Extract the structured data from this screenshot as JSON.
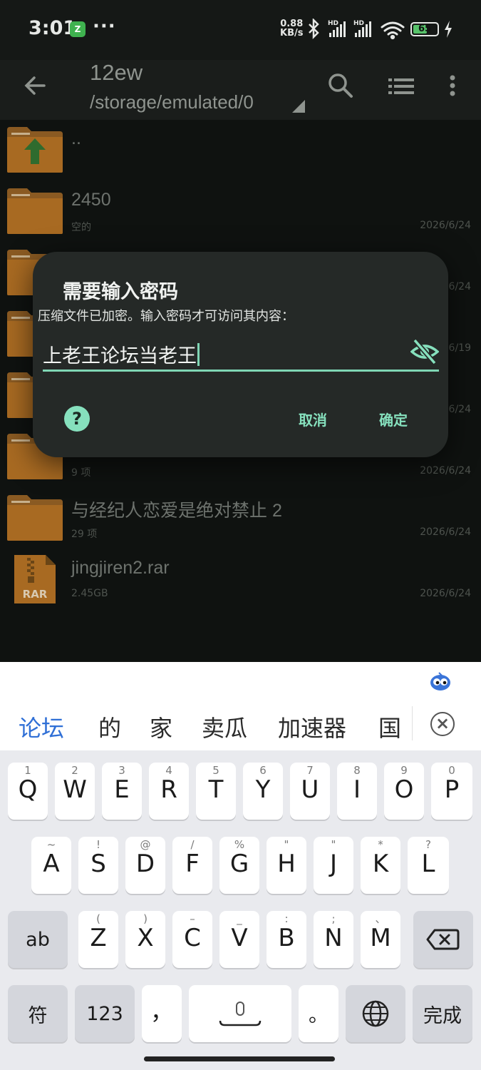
{
  "status_bar": {
    "time": "3:01",
    "app_badge": "Ⅸ",
    "dots": "···",
    "speed_value": "0.88",
    "speed_unit": "KB/s",
    "battery_level": "65",
    "icons": [
      "bluetooth-icon",
      "hd-signal-icon",
      "hd-signal-icon",
      "wifi-icon",
      "battery-icon",
      "charging-icon"
    ]
  },
  "app_bar": {
    "title": "12ew",
    "path": "/storage/emulated/0"
  },
  "files": [
    {
      "name": "..",
      "sub": "",
      "date": "",
      "type": "parent-folder"
    },
    {
      "name": "2450",
      "sub": "空的",
      "date": "2026/6/24",
      "type": "folder"
    },
    {
      "name": "",
      "sub": "",
      "date": "6/24",
      "type": "folder"
    },
    {
      "name": "",
      "sub": "",
      "date": "6/19",
      "type": "folder"
    },
    {
      "name": "",
      "sub": "",
      "date": "6/24",
      "type": "folder"
    },
    {
      "name": "",
      "sub": "9 项",
      "date": "2026/6/24",
      "type": "folder"
    },
    {
      "name": "与经纪人恋爱是绝对禁止 2",
      "sub": "29 项",
      "date": "2026/6/24",
      "type": "folder"
    },
    {
      "name": "jingjiren2.rar",
      "sub": "2.45GB",
      "date": "2026/6/24",
      "type": "rar"
    }
  ],
  "dialog": {
    "title": "需要输入密码",
    "message": "压缩文件已加密。输入密码才可访问其内容：",
    "password_value": "上老王论坛当老王",
    "help_label": "?",
    "cancel_label": "取消",
    "ok_label": "确定"
  },
  "keyboard": {
    "candidates": [
      "论坛",
      "的",
      "家",
      "卖瓜",
      "加速器",
      "国"
    ],
    "row1": [
      {
        "main": "Q",
        "sub": "1"
      },
      {
        "main": "W",
        "sub": "2"
      },
      {
        "main": "E",
        "sub": "3"
      },
      {
        "main": "R",
        "sub": "4"
      },
      {
        "main": "T",
        "sub": "5"
      },
      {
        "main": "Y",
        "sub": "6"
      },
      {
        "main": "U",
        "sub": "7"
      },
      {
        "main": "I",
        "sub": "8"
      },
      {
        "main": "O",
        "sub": "9"
      },
      {
        "main": "P",
        "sub": "0"
      }
    ],
    "row2": [
      {
        "main": "A",
        "sub": "~"
      },
      {
        "main": "S",
        "sub": "!"
      },
      {
        "main": "D",
        "sub": "@"
      },
      {
        "main": "F",
        "sub": "/"
      },
      {
        "main": "G",
        "sub": "%"
      },
      {
        "main": "H",
        "sub": "\""
      },
      {
        "main": "J",
        "sub": "\""
      },
      {
        "main": "K",
        "sub": "*"
      },
      {
        "main": "L",
        "sub": "?"
      }
    ],
    "row3": [
      {
        "main": "Z",
        "sub": "("
      },
      {
        "main": "X",
        "sub": ")"
      },
      {
        "main": "C",
        "sub": "–"
      },
      {
        "main": "V",
        "sub": "_"
      },
      {
        "main": "B",
        "sub": ":"
      },
      {
        "main": "N",
        "sub": ";"
      },
      {
        "main": "M",
        "sub": "、"
      }
    ],
    "shift_label": "ab",
    "symbol_label": "符",
    "num_label": "123",
    "comma_label": "，",
    "period_label": "。",
    "done_label": "完成"
  },
  "colors": {
    "accent": "#86e0bd",
    "candidate_active": "#2f6fd6"
  }
}
